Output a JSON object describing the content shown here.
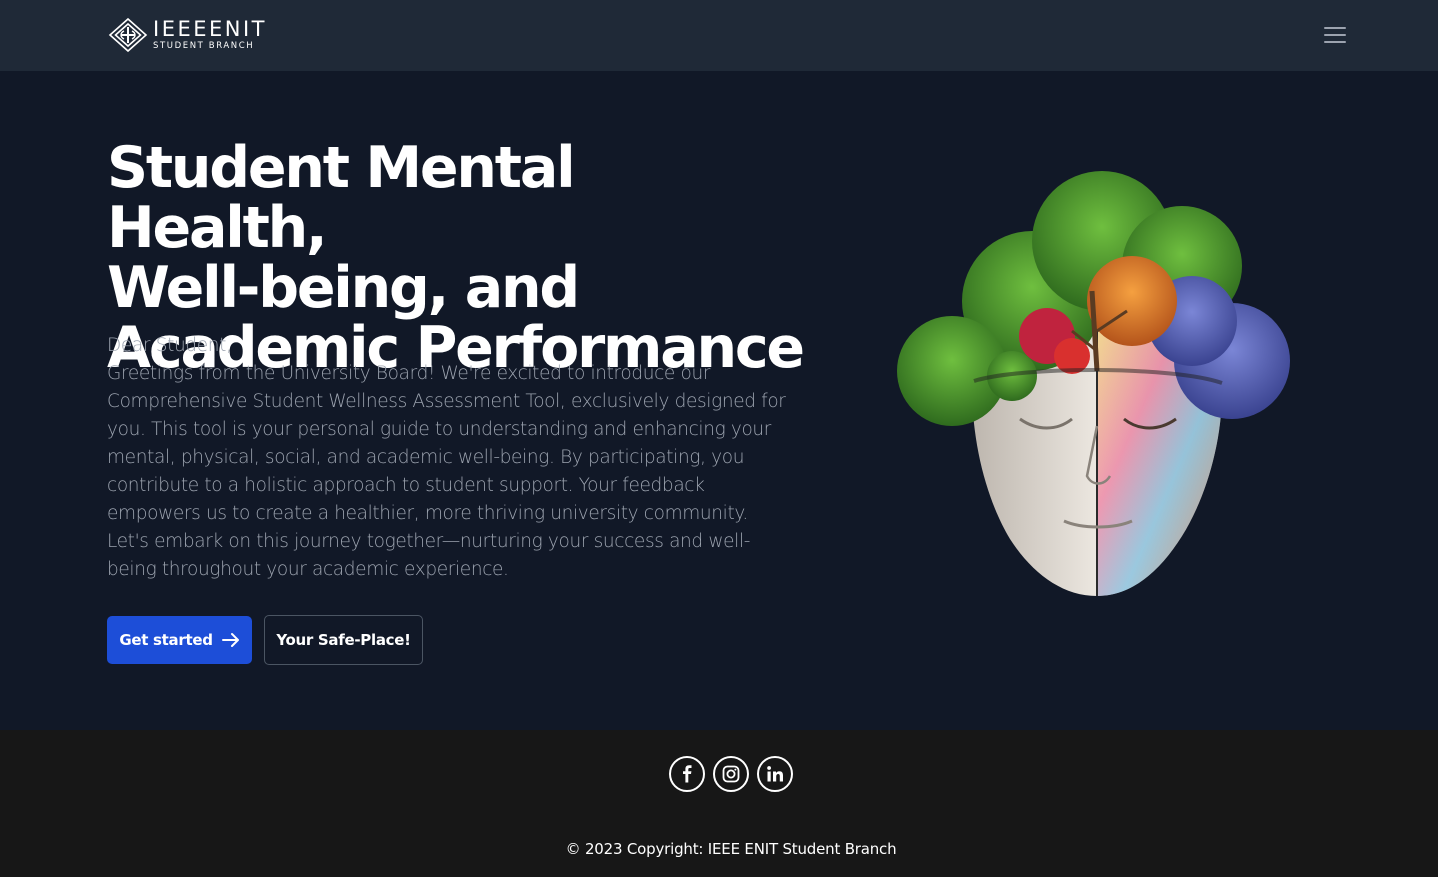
{
  "navbar": {
    "logo_title": "IEEEENIT",
    "logo_subtitle": "STUDENT BRANCH",
    "menu_icon": "hamburger-menu-icon"
  },
  "hero": {
    "title_lines": [
      "Student Mental Health,",
      "Well-being, and",
      "Academic Performance"
    ],
    "greeting": "Dear Student,",
    "body": "Greetings from the University Board! We're excited to introduce our Comprehensive Student Wellness Assessment Tool, exclusively designed for you. This tool is your personal guide to understanding and enhancing your mental, physical, social, and academic well-being. By participating, you contribute to a holistic approach to student support. Your feedback empowers us to create a healthier, more thriving university community. Let's embark on this journey together—nurturing your success and well-being throughout your academic experience.",
    "primary_button": "Get started",
    "primary_button_icon": "arrow-right-icon",
    "secondary_button": "Your Safe-Place!",
    "image": "human-head-with-trees-illustration"
  },
  "footer": {
    "socials": [
      "facebook-icon",
      "instagram-icon",
      "linkedin-icon"
    ],
    "copyright": "© 2023 Copyright: IEEE ENIT Student Branch"
  },
  "colors": {
    "navbar_bg": "#1f2937",
    "hero_bg": "#111827",
    "footer_bg": "#171717",
    "primary": "#1d4ed8",
    "body_text": "#9ca3af"
  }
}
